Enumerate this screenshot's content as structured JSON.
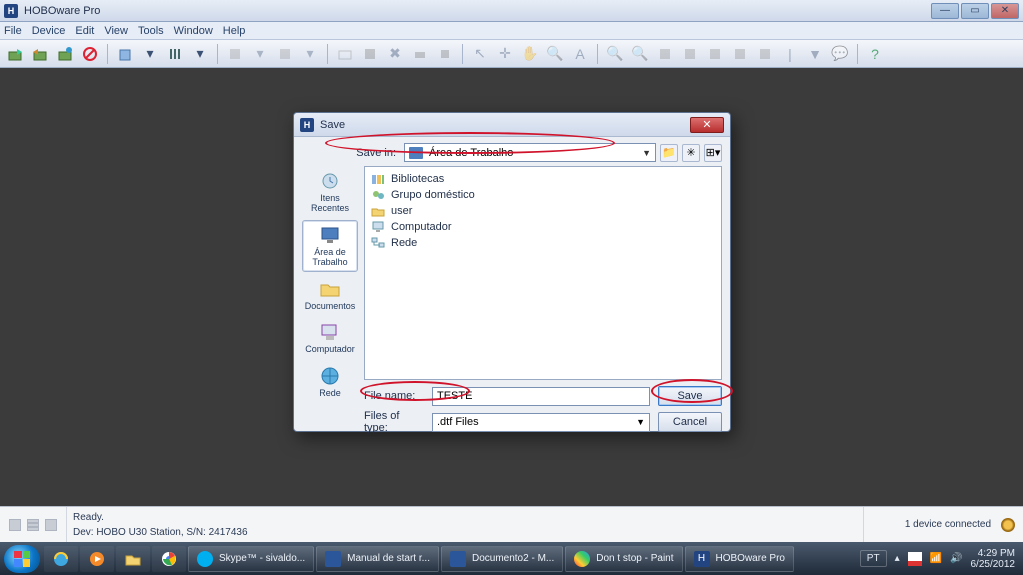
{
  "app": {
    "title": "HOBOware Pro"
  },
  "menu": {
    "items": [
      "File",
      "Device",
      "Edit",
      "View",
      "Tools",
      "Window",
      "Help"
    ]
  },
  "dialog": {
    "title": "Save",
    "savein_label": "Save in:",
    "savein_value": "Área de Trabalho",
    "sidebar": [
      {
        "label": "Itens Recentes"
      },
      {
        "label": "Área de Trabalho"
      },
      {
        "label": "Documentos"
      },
      {
        "label": "Computador"
      },
      {
        "label": "Rede"
      }
    ],
    "files": [
      {
        "name": "Bibliotecas",
        "icon": "libraries"
      },
      {
        "name": "Grupo doméstico",
        "icon": "homegroup"
      },
      {
        "name": "user",
        "icon": "user"
      },
      {
        "name": "Computador",
        "icon": "computer"
      },
      {
        "name": "Rede",
        "icon": "network"
      }
    ],
    "filename_label": "File name:",
    "filename_value": "TESTE",
    "filetype_label": "Files of type:",
    "filetype_value": ".dtf Files",
    "save_btn": "Save",
    "cancel_btn": "Cancel"
  },
  "status": {
    "ready": "Ready.",
    "device": "Dev: HOBO U30 Station, S/N: 2417436",
    "connected": "1 device connected"
  },
  "taskbar": {
    "items": [
      {
        "label": "Skype™ - sivaldo...",
        "color": "#00aff0"
      },
      {
        "label": "Manual de start r...",
        "color": "#2b579a"
      },
      {
        "label": "Documento2 - M...",
        "color": "#2b579a"
      },
      {
        "label": "Don t stop - Paint",
        "color": "#2d7dd2"
      },
      {
        "label": "HOBOware Pro",
        "color": "#224481"
      }
    ],
    "lang": "PT",
    "time": "4:29 PM",
    "date": "6/25/2012"
  }
}
